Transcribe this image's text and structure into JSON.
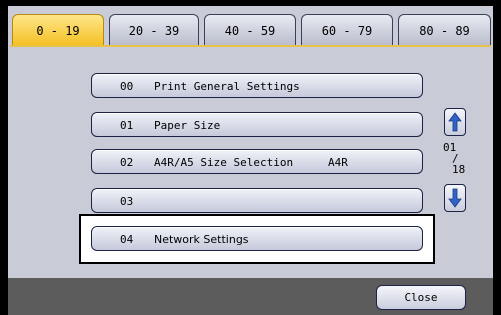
{
  "tabs": [
    {
      "label": "0 - 19",
      "active": true
    },
    {
      "label": "20 - 39",
      "active": false
    },
    {
      "label": "40 - 59",
      "active": false
    },
    {
      "label": "60 - 79",
      "active": false
    },
    {
      "label": "80 - 89",
      "active": false
    }
  ],
  "items": [
    {
      "num": "00",
      "label": "Print General Settings",
      "value": ""
    },
    {
      "num": "01",
      "label": "Paper Size",
      "value": ""
    },
    {
      "num": "02",
      "label": "A4R/A5 Size Selection",
      "value": "A4R"
    },
    {
      "num": "03",
      "label": "",
      "value": ""
    },
    {
      "num": "04",
      "label": "Network Settings",
      "value": "",
      "selected": true
    }
  ],
  "pager": {
    "current": "01",
    "separator": "/",
    "total": "18"
  },
  "icons": {
    "scroll_up": "up-arrow-icon",
    "scroll_down": "down-arrow-icon"
  },
  "close_label": "Close",
  "colors": {
    "active_tab": "#f4c022",
    "panel": "#c9ccd6",
    "arrow": "#2f63c6"
  }
}
